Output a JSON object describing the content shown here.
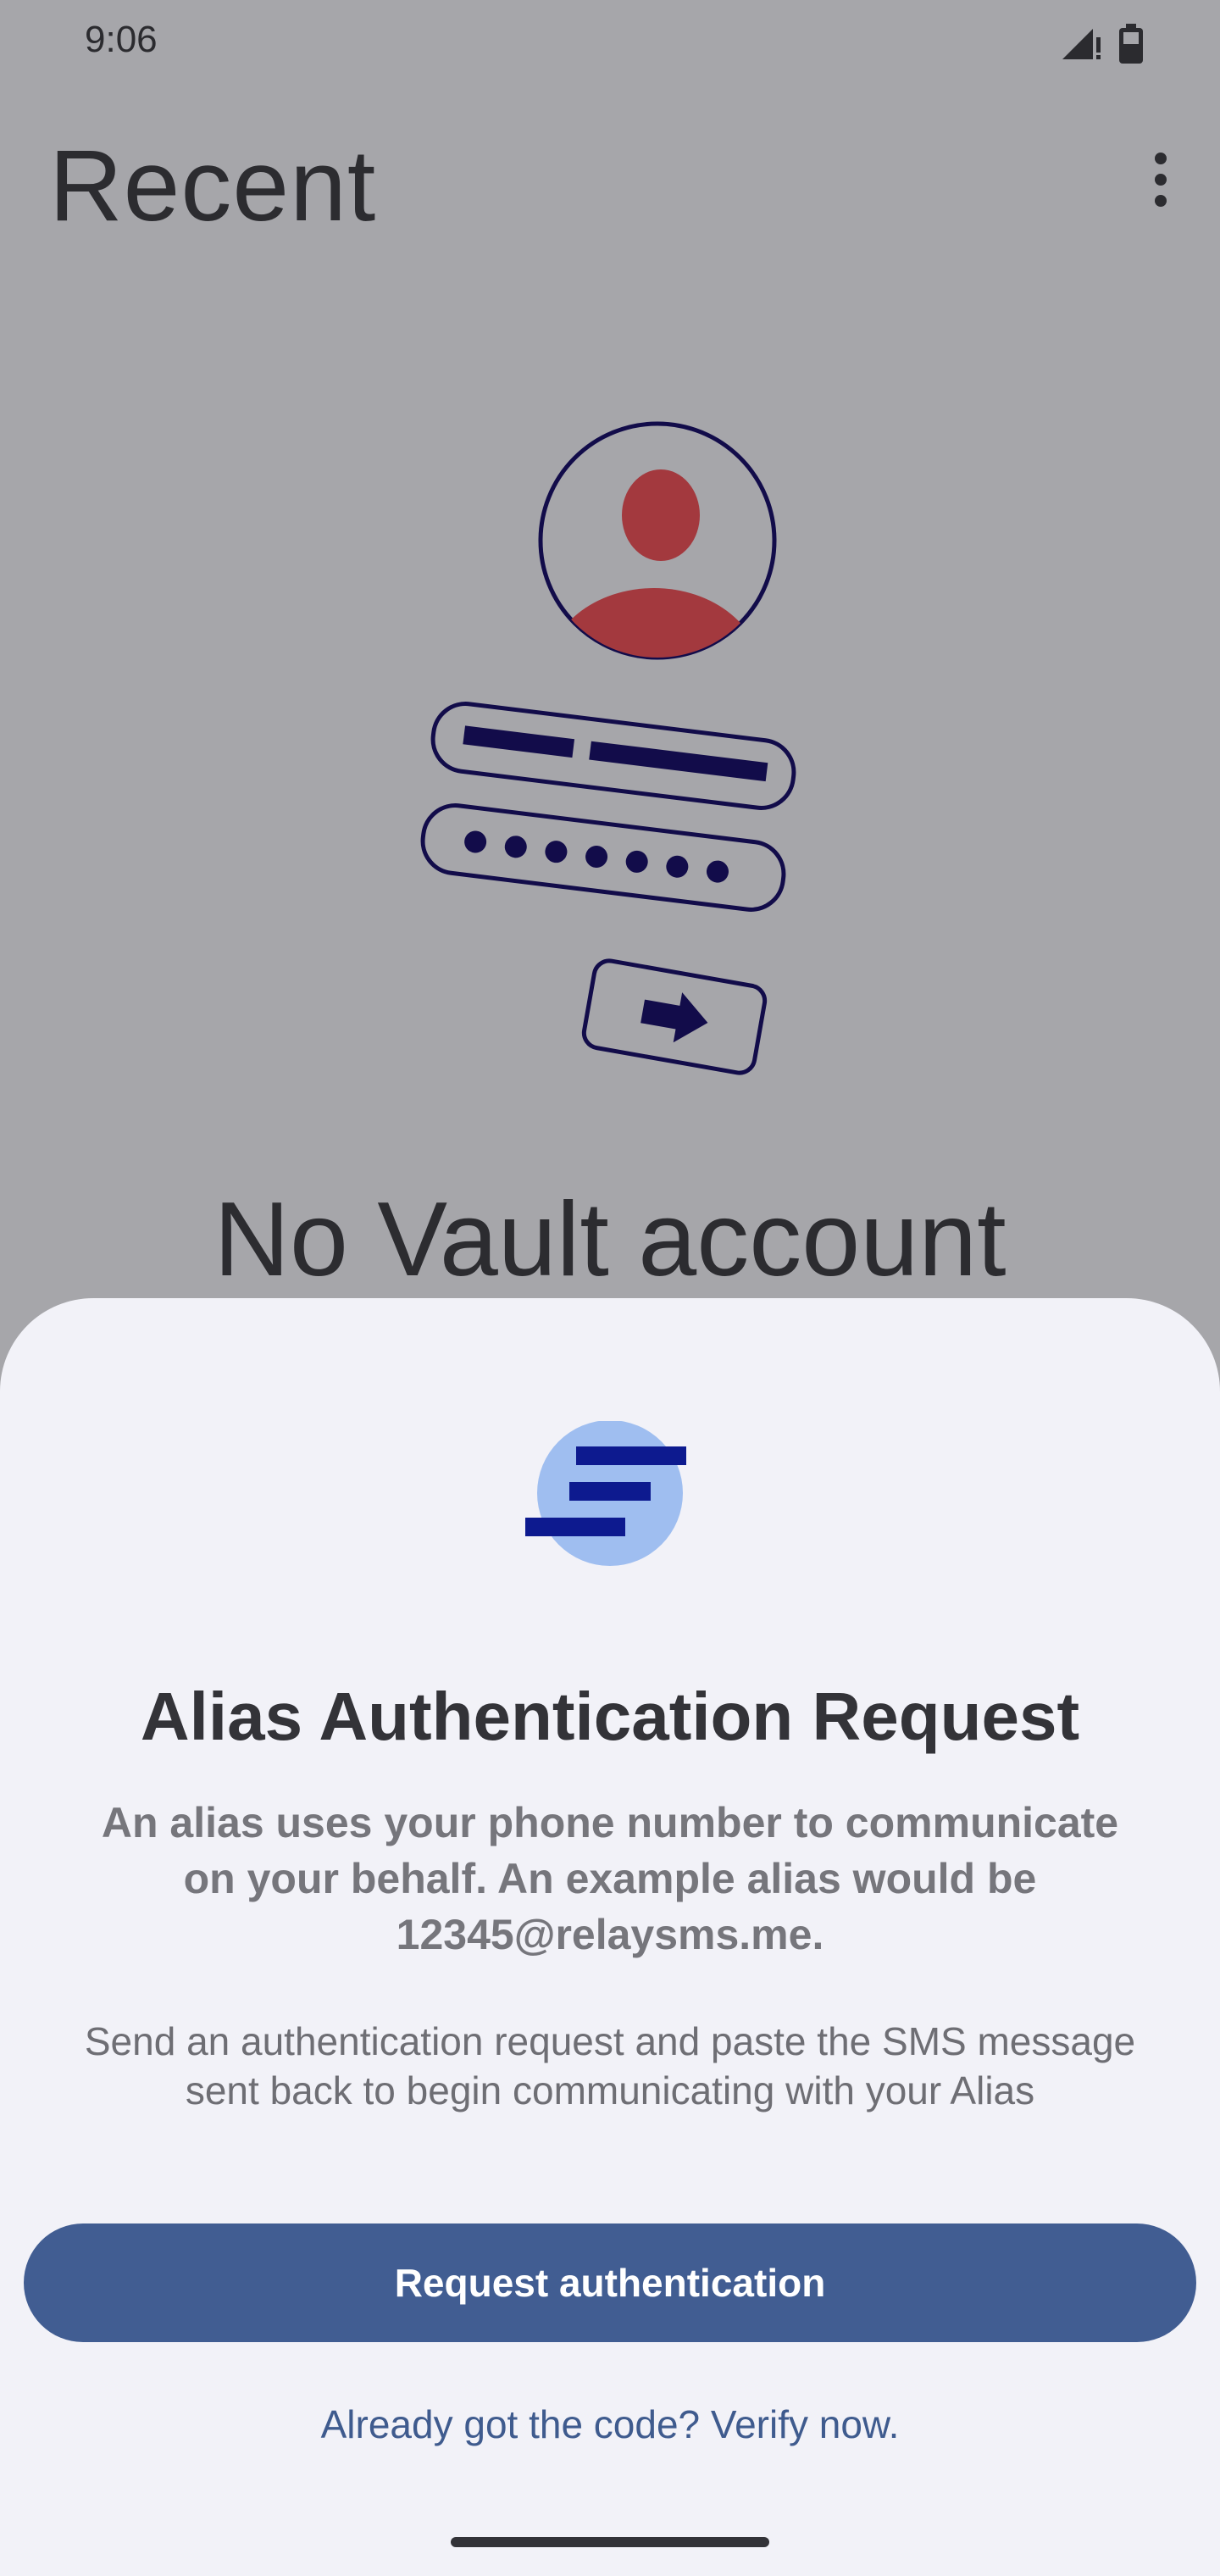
{
  "status_bar": {
    "time": "9:06",
    "signal_icon": "signal-icon",
    "battery_icon": "battery-icon"
  },
  "app_bar": {
    "title": "Recent",
    "menu_icon": "more-vert-icon"
  },
  "background": {
    "illustration": "login-illustration",
    "empty_title": "No Vault account"
  },
  "sheet": {
    "logo_icon": "relaysms-logo-icon",
    "title": "Alias Authentication Request",
    "description_line1": "An alias uses your phone number to communicate",
    "description_line2": "on your behalf. An example alias would be",
    "description_line3": "12345@relaysms.me.",
    "instructions_line1": "Send an authentication request and paste the SMS message",
    "instructions_line2": "sent back to begin communicating with your Alias",
    "primary_button": "Request authentication",
    "verify_link": "Already got the code? Verify now."
  },
  "colors": {
    "scrim": "#a6a6aa",
    "sheet_bg": "#f2f2f8",
    "primary": "#415d92",
    "illustration_red": "#a3393e",
    "illustration_navy": "#120c4a",
    "logo_light_blue": "#9fbef0",
    "logo_dark_blue": "#0d1a8f"
  }
}
